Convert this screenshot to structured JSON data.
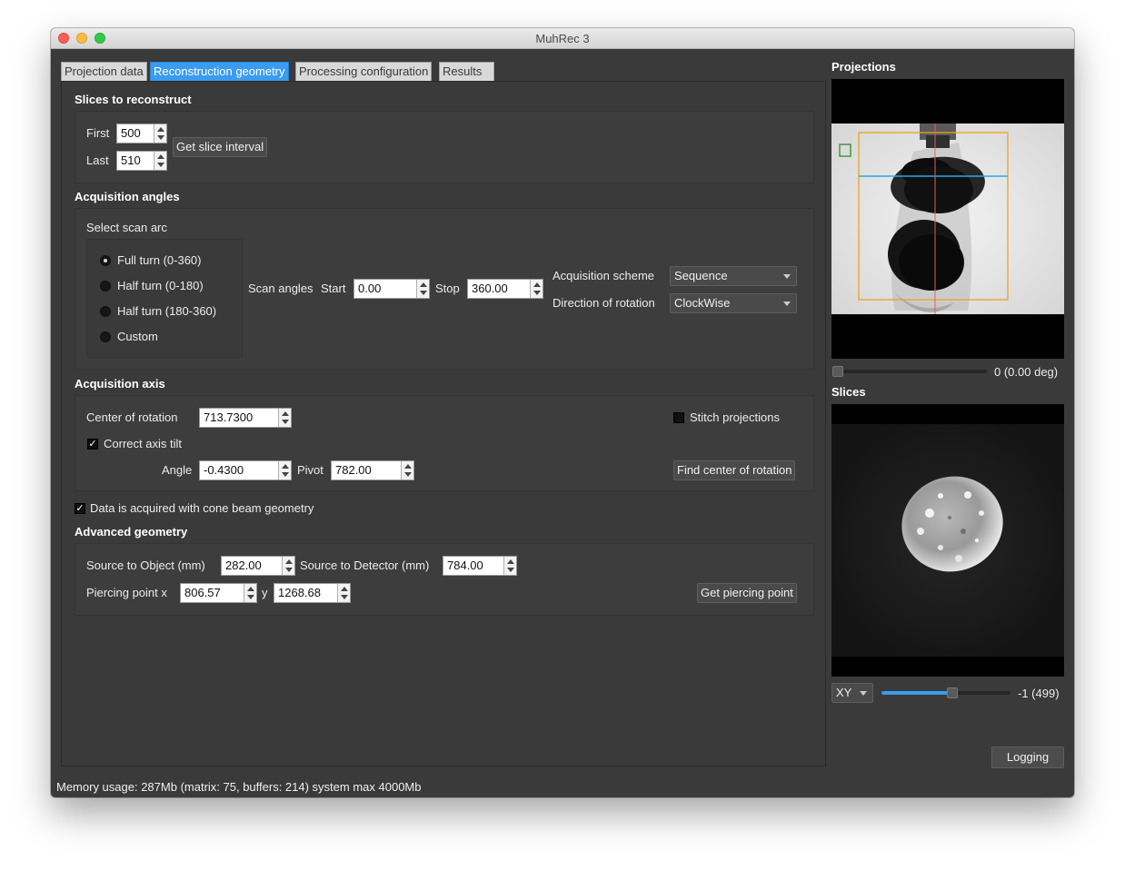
{
  "window": {
    "title": "MuhRec 3"
  },
  "tabs": [
    {
      "label": "Projection data"
    },
    {
      "label": "Reconstruction geometry"
    },
    {
      "label": "Processing configuration"
    },
    {
      "label": "Results"
    }
  ],
  "slices": {
    "title": "Slices to reconstruct",
    "first_label": "First",
    "first_value": "500",
    "last_label": "Last",
    "last_value": "510",
    "get_interval_label": "Get slice interval"
  },
  "angles": {
    "title": "Acquisition angles",
    "select_arc_label": "Select scan arc",
    "options": [
      {
        "label": "Full turn (0-360)",
        "checked": true
      },
      {
        "label": "Half turn (0-180)",
        "checked": false
      },
      {
        "label": "Half turn (180-360)",
        "checked": false
      },
      {
        "label": "Custom",
        "checked": false
      }
    ],
    "scan_angles_label": "Scan angles",
    "start_label": "Start",
    "start_value": "0.00",
    "stop_label": "Stop",
    "stop_value": "360.00",
    "scheme_label": "Acquisition scheme",
    "scheme_value": "Sequence",
    "direction_label": "Direction of rotation",
    "direction_value": "ClockWise"
  },
  "axis": {
    "title": "Acquisition axis",
    "center_label": "Center of rotation",
    "center_value": "713.7300",
    "stitch_label": "Stitch projections",
    "stitch_checked": false,
    "tilt_label": "Correct axis tilt",
    "tilt_checked": true,
    "angle_label": "Angle",
    "angle_value": "-0.4300",
    "pivot_label": "Pivot",
    "pivot_value": "782.00",
    "find_center_label": "Find center of rotation"
  },
  "cone": {
    "checkbox_label": "Data is acquired with cone beam geometry",
    "checked": true
  },
  "advanced": {
    "title": "Advanced geometry",
    "sod_label": "Source to Object  (mm)",
    "sod_value": "282.00",
    "sdd_label": "Source to Detector (mm)",
    "sdd_value": "784.00",
    "piercing_label": "Piercing point  x",
    "piercing_x": "806.57",
    "y_label": "y",
    "piercing_y": "1268.68",
    "get_piercing_label": "Get piercing point"
  },
  "projections": {
    "title": "Projections",
    "slider_readout": "0 (0.00 deg)",
    "slider_fraction": 0.0
  },
  "slices_view": {
    "title": "Slices",
    "plane_value": "XY",
    "slider_readout": "-1 (499)",
    "slider_fraction": 0.55
  },
  "logging_label": "Logging",
  "status": "Memory usage: 287Mb (matrix: 75, buffers: 214) system max 4000Mb",
  "colors": {
    "tab_active": "#3a9cf0",
    "roi_orange": "#f0a020",
    "slice_line_blue": "#2aa8e8"
  }
}
